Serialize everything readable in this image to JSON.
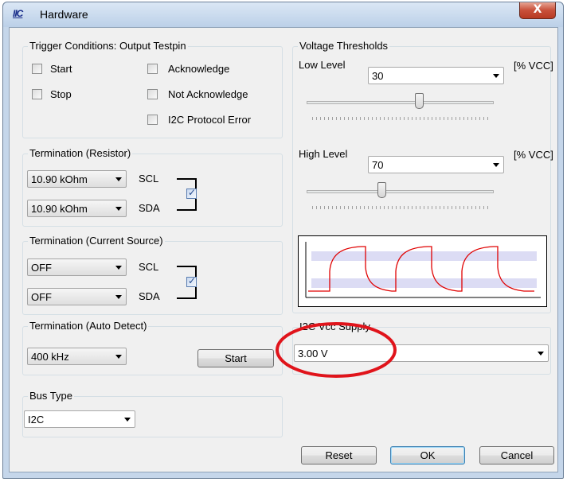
{
  "window": {
    "title": "Hardware",
    "icon_text": "IIC",
    "close_glyph": "X"
  },
  "trigger": {
    "label": "Trigger Conditions: Output Testpin",
    "start": "Start",
    "stop": "Stop",
    "acknowledge": "Acknowledge",
    "not_acknowledge": "Not Acknowledge",
    "protocol_error": "I2C Protocol Error"
  },
  "term_resistor": {
    "label": "Termination (Resistor)",
    "scl_value": "10.90 kOhm",
    "sda_value": "10.90 kOhm",
    "scl": "SCL",
    "sda": "SDA",
    "linked": true
  },
  "term_current": {
    "label": "Termination (Current Source)",
    "scl_value": "OFF",
    "sda_value": "OFF",
    "scl": "SCL",
    "sda": "SDA",
    "linked": true
  },
  "term_auto": {
    "label": "Termination (Auto Detect)",
    "value": "400 kHz",
    "start_label": "Start"
  },
  "bus": {
    "label": "Bus Type",
    "value": "I2C"
  },
  "voltage": {
    "label": "Voltage Thresholds",
    "low_label": "Low Level",
    "low_value": "30",
    "low_unit": "[% VCC]",
    "high_label": "High Level",
    "high_value": "70",
    "high_unit": "[% VCC]",
    "low_fraction": 0.6,
    "high_fraction": 0.4
  },
  "supply": {
    "label": "I2C Vcc Supply",
    "value": "3.00 V"
  },
  "buttons": {
    "reset": "Reset",
    "ok": "OK",
    "cancel": "Cancel"
  },
  "colors": {
    "annotation": "#e0141b",
    "wave": "#e00000",
    "band": "#dcdcf4"
  }
}
